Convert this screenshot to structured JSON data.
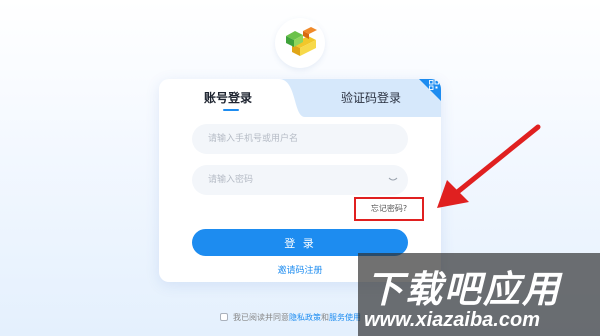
{
  "tabs": {
    "account_login": "账号登录",
    "code_login": "验证码登录"
  },
  "form": {
    "phone_placeholder": "请输入手机号或用户名",
    "password_placeholder": "请输入密码",
    "forgot_password": "忘记密码?",
    "login_button": "登 录",
    "invite_register": "邀请码注册"
  },
  "agreement": {
    "prefix": "我已阅读并同意",
    "privacy": "隐私政策",
    "and": "和",
    "service": "服务使用"
  },
  "watermark": {
    "brand": "下载吧应用",
    "url": "www.xiazaiba.com"
  },
  "colors": {
    "accent": "#1d8cf0",
    "highlight": "#e02020"
  }
}
